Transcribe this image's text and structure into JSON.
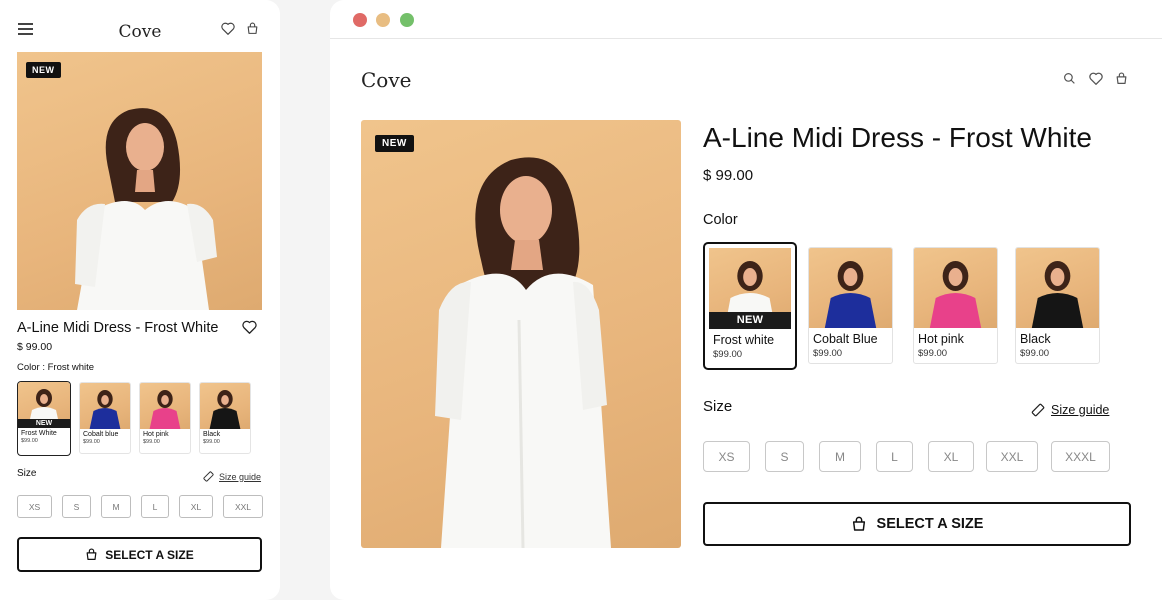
{
  "mobile": {
    "logo": "Cove",
    "badge": "NEW",
    "title": "A-Line Midi Dress - Frost White",
    "price": "$ 99.00",
    "color_label": "Color : Frost white",
    "swatches": [
      {
        "name": "Frost White",
        "price": "$99.00",
        "badge": "NEW"
      },
      {
        "name": "Cobalt blue",
        "price": "$99.00"
      },
      {
        "name": "Hot pink",
        "price": "$99.00"
      },
      {
        "name": "Black",
        "price": "$99.00"
      }
    ],
    "size_label": "Size",
    "size_guide": "Size guide",
    "sizes": [
      "XS",
      "S",
      "M",
      "L",
      "XL",
      "XXL"
    ],
    "cta": "SELECT A SIZE"
  },
  "desktop": {
    "window_dots": [
      "#e06a66",
      "#e8bd82",
      "#74c06a"
    ],
    "logo": "Cove",
    "badge": "NEW",
    "title": "A-Line Midi Dress - Frost White",
    "price": "$ 99.00",
    "color_label": "Color",
    "swatches": [
      {
        "name": "Frost white",
        "price": "$99.00",
        "badge": "NEW"
      },
      {
        "name": "Cobalt Blue",
        "price": "$99.00"
      },
      {
        "name": "Hot pink",
        "price": "$99.00"
      },
      {
        "name": "Black",
        "price": "$99.00"
      }
    ],
    "size_label": "Size",
    "size_guide": "Size guide",
    "sizes": [
      "XS",
      "S",
      "M",
      "L",
      "XL",
      "XXL",
      "XXXL"
    ],
    "cta": "SELECT A SIZE"
  },
  "icons": {
    "menu": "hamburger-menu-icon",
    "heart": "heart-icon",
    "bag": "shopping-bag-icon",
    "search": "search-icon",
    "ruler": "ruler-icon"
  },
  "colors": {
    "photo_background": "#e8b57c",
    "dress_white": "#f8f8f6",
    "cobalt_blue": "#1d2e9c",
    "hot_pink": "#e8418a",
    "black": "#151515",
    "accent_dark": "#111111"
  }
}
